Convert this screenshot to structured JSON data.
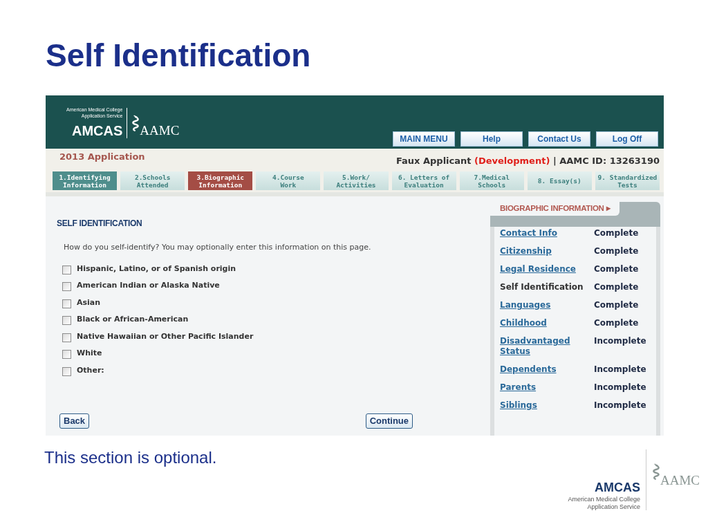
{
  "slide": {
    "title": "Self Identification",
    "caption": "This section is optional."
  },
  "header": {
    "logo": {
      "org_line1": "American Medical College",
      "org_line2": "Application Service",
      "amcas": "AMCAS",
      "aamc": "AAMC"
    },
    "nav_buttons": [
      "MAIN MENU",
      "Help",
      "Contact Us",
      "Log Off"
    ]
  },
  "info_bar": {
    "application": "2013 Application",
    "applicant": "Faux Applicant",
    "environment": "(Development)",
    "separator": "|",
    "id": "AAMC ID: 13263190"
  },
  "tabs": [
    {
      "lines": [
        "1.Identifying",
        "Information"
      ],
      "selected": false,
      "complete": true
    },
    {
      "lines": [
        "2.Schools",
        "Attended"
      ],
      "selected": false,
      "complete": false
    },
    {
      "lines": [
        "3.Biographic",
        "Information"
      ],
      "selected": true,
      "complete": false
    },
    {
      "lines": [
        "4.Course",
        "Work"
      ],
      "selected": false,
      "complete": false
    },
    {
      "lines": [
        "5.Work/",
        "Activities"
      ],
      "selected": false,
      "complete": false
    },
    {
      "lines": [
        "6. Letters of",
        "Evaluation"
      ],
      "selected": false,
      "complete": false
    },
    {
      "lines": [
        "7.Medical",
        "Schools"
      ],
      "selected": false,
      "complete": false
    },
    {
      "lines": [
        "8. Essay(s)"
      ],
      "selected": false,
      "complete": false
    },
    {
      "lines": [
        "9. Standardized",
        "Tests"
      ],
      "selected": false,
      "complete": false
    }
  ],
  "form": {
    "heading": "SELF IDENTIFICATION",
    "question": "How do you self-identify? You may optionally enter this information on this page.",
    "options": [
      {
        "label": "Hispanic, Latino, or of Spanish origin",
        "checked": false
      },
      {
        "label": "American Indian or Alaska Native",
        "checked": false
      },
      {
        "label": "Asian",
        "checked": false
      },
      {
        "label": "Black or African-American",
        "checked": false
      },
      {
        "label": "Native Hawaiian or Other Pacific Islander",
        "checked": false
      },
      {
        "label": "White",
        "checked": false
      },
      {
        "label": "Other:",
        "checked": false
      }
    ],
    "buttons": [
      "Back",
      "Continue"
    ]
  },
  "sidebar": {
    "heading": "BIOGRAPHIC INFORMATION",
    "arrow": "▸",
    "items": [
      {
        "label": "Contact Info",
        "status": "Complete",
        "selected": false
      },
      {
        "label": "Citizenship",
        "status": "Complete",
        "selected": false
      },
      {
        "label": "Legal Residence",
        "status": "Complete",
        "selected": false
      },
      {
        "label": "Self Identification",
        "status": "Complete",
        "selected": true
      },
      {
        "label": "Languages",
        "status": "Complete",
        "selected": false
      },
      {
        "label": "Childhood",
        "status": "Complete",
        "selected": false
      },
      {
        "label": "Disadvantaged Status",
        "status": "Incomplete",
        "selected": false
      },
      {
        "label": "Dependents",
        "status": "Incomplete",
        "selected": false
      },
      {
        "label": "Parents",
        "status": "Incomplete",
        "selected": false
      },
      {
        "label": "Siblings",
        "status": "Incomplete",
        "selected": false
      }
    ]
  },
  "footer_logo": {
    "amcas": "AMCAS",
    "org_line1": "American Medical College",
    "org_line2": "Application Service",
    "aamc": "AAMC"
  }
}
